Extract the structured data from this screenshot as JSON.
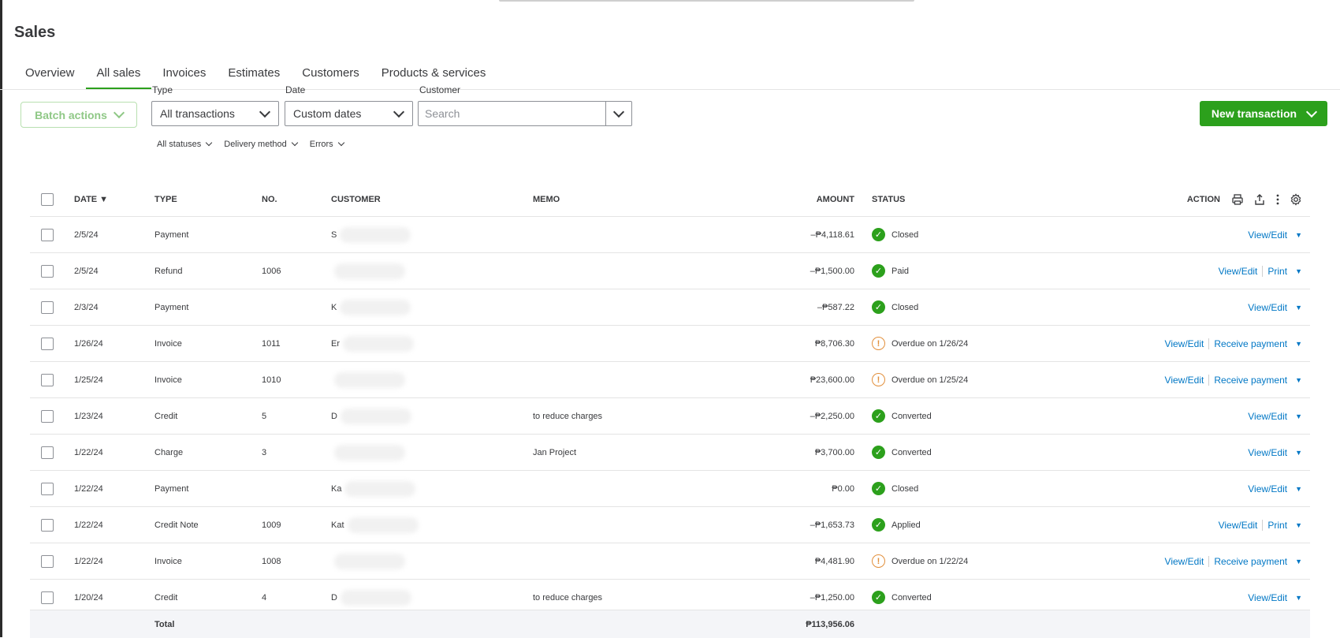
{
  "page": {
    "title": "Sales"
  },
  "tabs": [
    {
      "label": "Overview",
      "active": false
    },
    {
      "label": "All sales",
      "active": true
    },
    {
      "label": "Invoices",
      "active": false
    },
    {
      "label": "Estimates",
      "active": false
    },
    {
      "label": "Customers",
      "active": false
    },
    {
      "label": "Products & services",
      "active": false
    }
  ],
  "toolbar": {
    "batch_actions": "Batch actions",
    "type_label": "Type",
    "type_value": "All transactions",
    "date_label": "Date",
    "date_value": "Custom dates",
    "customer_label": "Customer",
    "customer_placeholder": "Search",
    "new_transaction": "New transaction"
  },
  "subfilters": [
    "All statuses",
    "Delivery method",
    "Errors"
  ],
  "table": {
    "headers": {
      "date": "DATE ▼",
      "type": "TYPE",
      "no": "NO.",
      "customer": "CUSTOMER",
      "memo": "MEMO",
      "amount": "AMOUNT",
      "status": "STATUS",
      "action": "ACTION"
    },
    "rows": [
      {
        "date": "2/5/24",
        "type": "Payment",
        "no": "",
        "customer": "S",
        "memo": "",
        "amount": "–₱4,118.61",
        "status": "Closed",
        "status_kind": "ok",
        "actions": [
          "View/Edit"
        ]
      },
      {
        "date": "2/5/24",
        "type": "Refund",
        "no": "1006",
        "customer": "",
        "memo": "",
        "amount": "–₱1,500.00",
        "status": "Paid",
        "status_kind": "ok",
        "actions": [
          "View/Edit",
          "Print"
        ]
      },
      {
        "date": "2/3/24",
        "type": "Payment",
        "no": "",
        "customer": "K",
        "memo": "",
        "amount": "–₱587.22",
        "status": "Closed",
        "status_kind": "ok",
        "actions": [
          "View/Edit"
        ]
      },
      {
        "date": "1/26/24",
        "type": "Invoice",
        "no": "1011",
        "customer": "Er",
        "memo": "",
        "amount": "₱8,706.30",
        "status": "Overdue on 1/26/24",
        "status_kind": "warn",
        "actions": [
          "View/Edit",
          "Receive payment"
        ]
      },
      {
        "date": "1/25/24",
        "type": "Invoice",
        "no": "1010",
        "customer": "",
        "memo": "",
        "amount": "₱23,600.00",
        "status": "Overdue on 1/25/24",
        "status_kind": "warn",
        "actions": [
          "View/Edit",
          "Receive payment"
        ]
      },
      {
        "date": "1/23/24",
        "type": "Credit",
        "no": "5",
        "customer": "D",
        "memo": "to reduce charges",
        "amount": "–₱2,250.00",
        "status": "Converted",
        "status_kind": "ok",
        "actions": [
          "View/Edit"
        ]
      },
      {
        "date": "1/22/24",
        "type": "Charge",
        "no": "3",
        "customer": "",
        "memo": "Jan Project",
        "amount": "₱3,700.00",
        "status": "Converted",
        "status_kind": "ok",
        "actions": [
          "View/Edit"
        ]
      },
      {
        "date": "1/22/24",
        "type": "Payment",
        "no": "",
        "customer": "Ka",
        "memo": "",
        "amount": "₱0.00",
        "status": "Closed",
        "status_kind": "ok",
        "actions": [
          "View/Edit"
        ]
      },
      {
        "date": "1/22/24",
        "type": "Credit Note",
        "no": "1009",
        "customer": "Kat",
        "memo": "",
        "amount": "–₱1,653.73",
        "status": "Applied",
        "status_kind": "ok",
        "actions": [
          "View/Edit",
          "Print"
        ]
      },
      {
        "date": "1/22/24",
        "type": "Invoice",
        "no": "1008",
        "customer": "",
        "memo": "",
        "amount": "₱4,481.90",
        "status": "Overdue on 1/22/24",
        "status_kind": "warn",
        "actions": [
          "View/Edit",
          "Receive payment"
        ]
      },
      {
        "date": "1/20/24",
        "type": "Credit",
        "no": "4",
        "customer": "D",
        "memo": "to reduce charges",
        "amount": "–₱1,250.00",
        "status": "Converted",
        "status_kind": "ok",
        "actions": [
          "View/Edit"
        ]
      }
    ],
    "total_label": "Total",
    "total_amount": "₱113,956.06"
  },
  "colors": {
    "accent": "#2ca01c",
    "link": "#0077c5",
    "warning": "#e28f3b"
  },
  "icons": {
    "header": [
      "print-icon",
      "export-icon",
      "more-icon",
      "settings-icon"
    ]
  }
}
